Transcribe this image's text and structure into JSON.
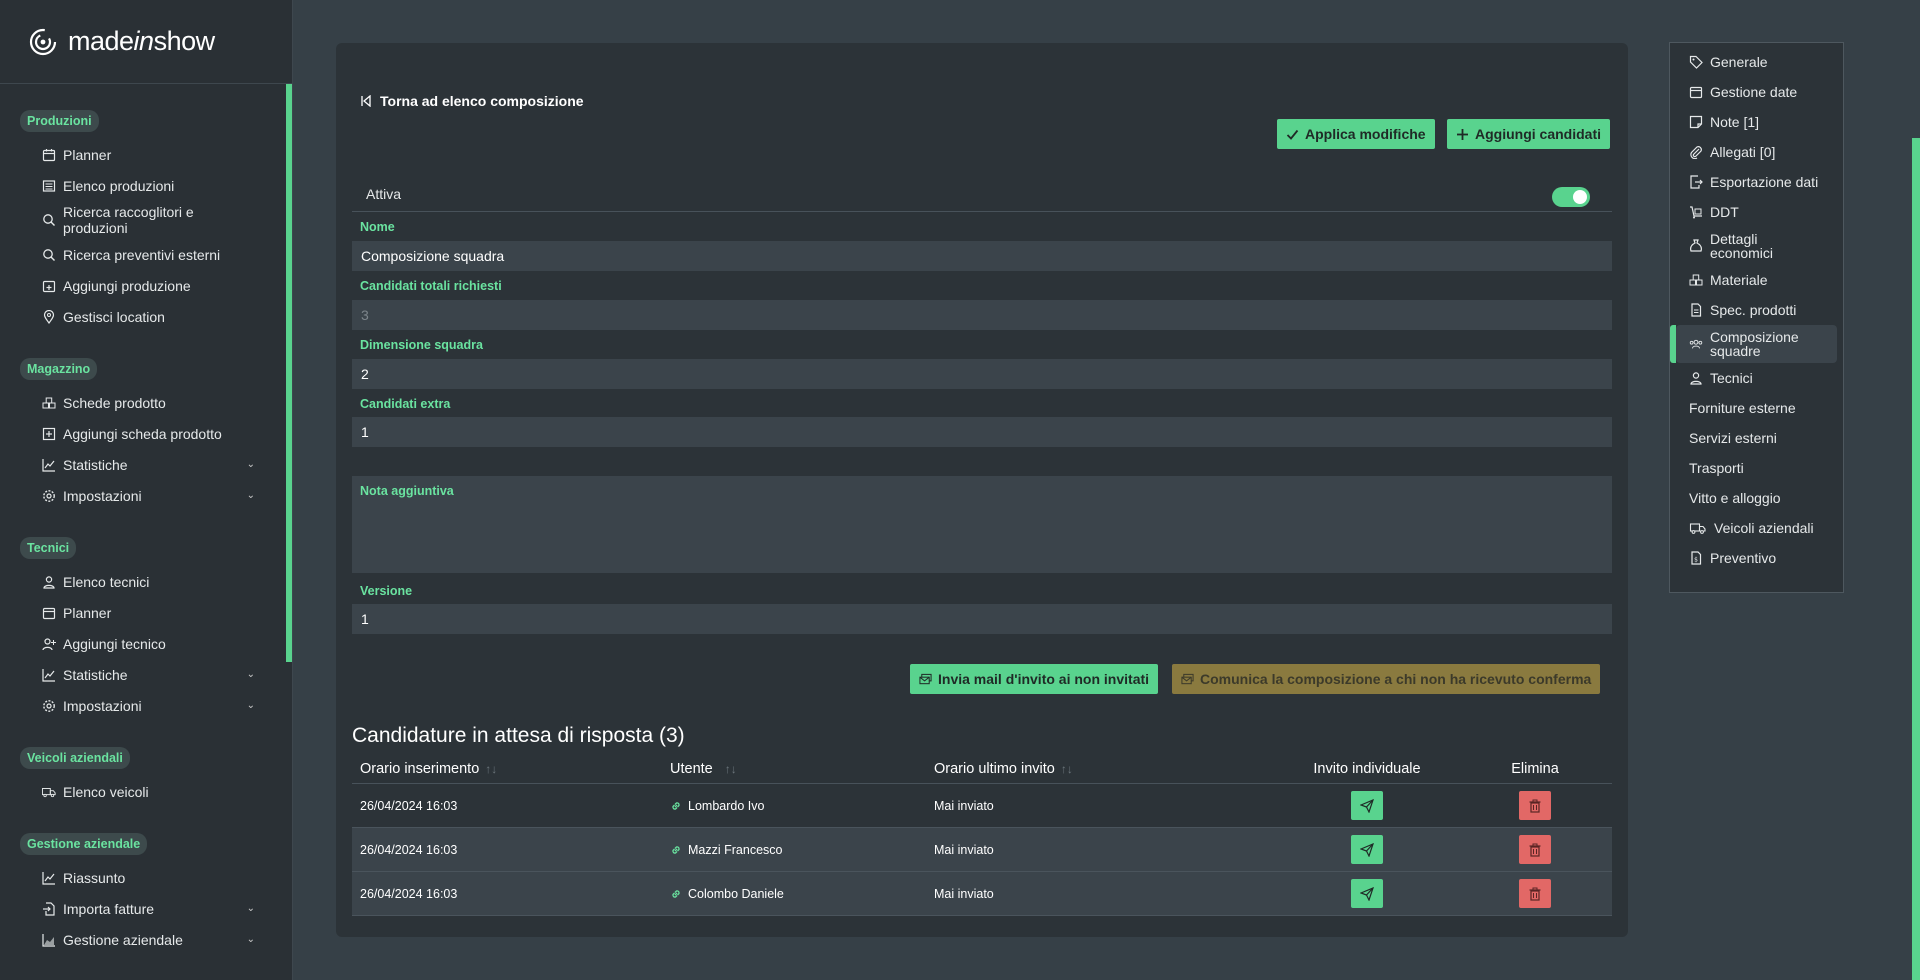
{
  "brand": {
    "logo_pre": "made",
    "logo_mid": "in",
    "logo_post": "show"
  },
  "sidebar": {
    "sections": [
      {
        "title": "Produzioni",
        "items": [
          {
            "label": "Planner",
            "icon": "calendar-icon"
          },
          {
            "label": "Elenco produzioni",
            "icon": "list-icon"
          },
          {
            "label": "Ricerca raccoglitori e produzioni",
            "icon": "search-icon"
          },
          {
            "label": "Ricerca preventivi esterni",
            "icon": "search-icon"
          },
          {
            "label": "Aggiungi produzione",
            "icon": "calendar-plus-icon"
          },
          {
            "label": "Gestisci location",
            "icon": "map-pin-icon"
          }
        ]
      },
      {
        "title": "Magazzino",
        "items": [
          {
            "label": "Schede prodotto",
            "icon": "boxes-icon"
          },
          {
            "label": "Aggiungi scheda prodotto",
            "icon": "plus-square-icon"
          },
          {
            "label": "Statistiche",
            "icon": "chart-line-icon"
          },
          {
            "label": "Impostazioni",
            "icon": "gear-icon"
          }
        ]
      },
      {
        "title": "Tecnici",
        "items": [
          {
            "label": "Elenco tecnici",
            "icon": "user-icon"
          },
          {
            "label": "Planner",
            "icon": "calendar-icon"
          },
          {
            "label": "Aggiungi tecnico",
            "icon": "user-plus-icon"
          },
          {
            "label": "Statistiche",
            "icon": "chart-line-icon"
          },
          {
            "label": "Impostazioni",
            "icon": "gear-icon"
          }
        ]
      },
      {
        "title": "Veicoli aziendali",
        "items": [
          {
            "label": "Elenco veicoli",
            "icon": "truck-icon"
          }
        ]
      },
      {
        "title": "Gestione aziendale",
        "items": [
          {
            "label": "Riassunto",
            "icon": "chart-line-icon"
          },
          {
            "label": "Importa fatture",
            "icon": "file-import-icon"
          },
          {
            "label": "Gestione aziendale",
            "icon": "chart-area-icon"
          }
        ]
      }
    ]
  },
  "form": {
    "back_label": "Torna ad elenco composizione",
    "apply_label": "Applica modifiche",
    "add_label": "Aggiungi candidati",
    "active_label": "Attiva",
    "active_value": true,
    "name_label": "Nome",
    "name_value": "Composizione squadra",
    "total_label": "Candidati totali richiesti",
    "total_value": "3",
    "size_label": "Dimensione squadra",
    "size_value": "2",
    "extra_label": "Candidati extra",
    "extra_value": "1",
    "note_label": "Nota aggiuntiva",
    "note_value": "",
    "version_label": "Versione",
    "version_value": "1",
    "invite_btn": "Invia mail d'invito ai non invitati",
    "notify_btn": "Comunica la composizione a chi non ha ricevuto conferma"
  },
  "table": {
    "title": "Candidature in attesa di risposta (3)",
    "headers": [
      "Orario inserimento",
      "Utente",
      "Orario ultimo invito",
      "Invito individuale",
      "Elimina"
    ],
    "rows": [
      {
        "time": "26/04/2024 16:03",
        "user": "Lombardo Ivo",
        "last": "Mai inviato"
      },
      {
        "time": "26/04/2024 16:03",
        "user": "Mazzi Francesco",
        "last": "Mai inviato"
      },
      {
        "time": "26/04/2024 16:03",
        "user": "Colombo Daniele",
        "last": "Mai inviato"
      }
    ]
  },
  "rightnav": {
    "items": [
      {
        "label": "Generale",
        "icon": "tag-icon"
      },
      {
        "label": "Gestione date",
        "icon": "calendar-icon"
      },
      {
        "label": "Note [1]",
        "icon": "note-icon"
      },
      {
        "label": "Allegati [0]",
        "icon": "paperclip-icon"
      },
      {
        "label": "Esportazione dati",
        "icon": "file-export-icon"
      },
      {
        "label": "DDT",
        "icon": "dolly-icon"
      },
      {
        "label": "Dettagli economici",
        "icon": "money-bag-icon"
      },
      {
        "label": "Materiale",
        "icon": "boxes-icon"
      },
      {
        "label": "Spec. prodotti",
        "icon": "file-icon"
      },
      {
        "label": "Composizione squadre",
        "icon": "users-icon",
        "active": true
      },
      {
        "label": "Tecnici",
        "icon": "user-icon"
      },
      {
        "label": "Forniture esterne",
        "icon": ""
      },
      {
        "label": "Servizi esterni",
        "icon": ""
      },
      {
        "label": "Trasporti",
        "icon": ""
      },
      {
        "label": "Vitto e alloggio",
        "icon": ""
      },
      {
        "label": "Veicoli aziendali",
        "icon": "truck-icon"
      },
      {
        "label": "Preventivo",
        "icon": "file-invoice-icon"
      }
    ]
  },
  "colors": {
    "accent": "#59d38e",
    "danger": "#e26866",
    "warning": "#8a7a3f"
  }
}
